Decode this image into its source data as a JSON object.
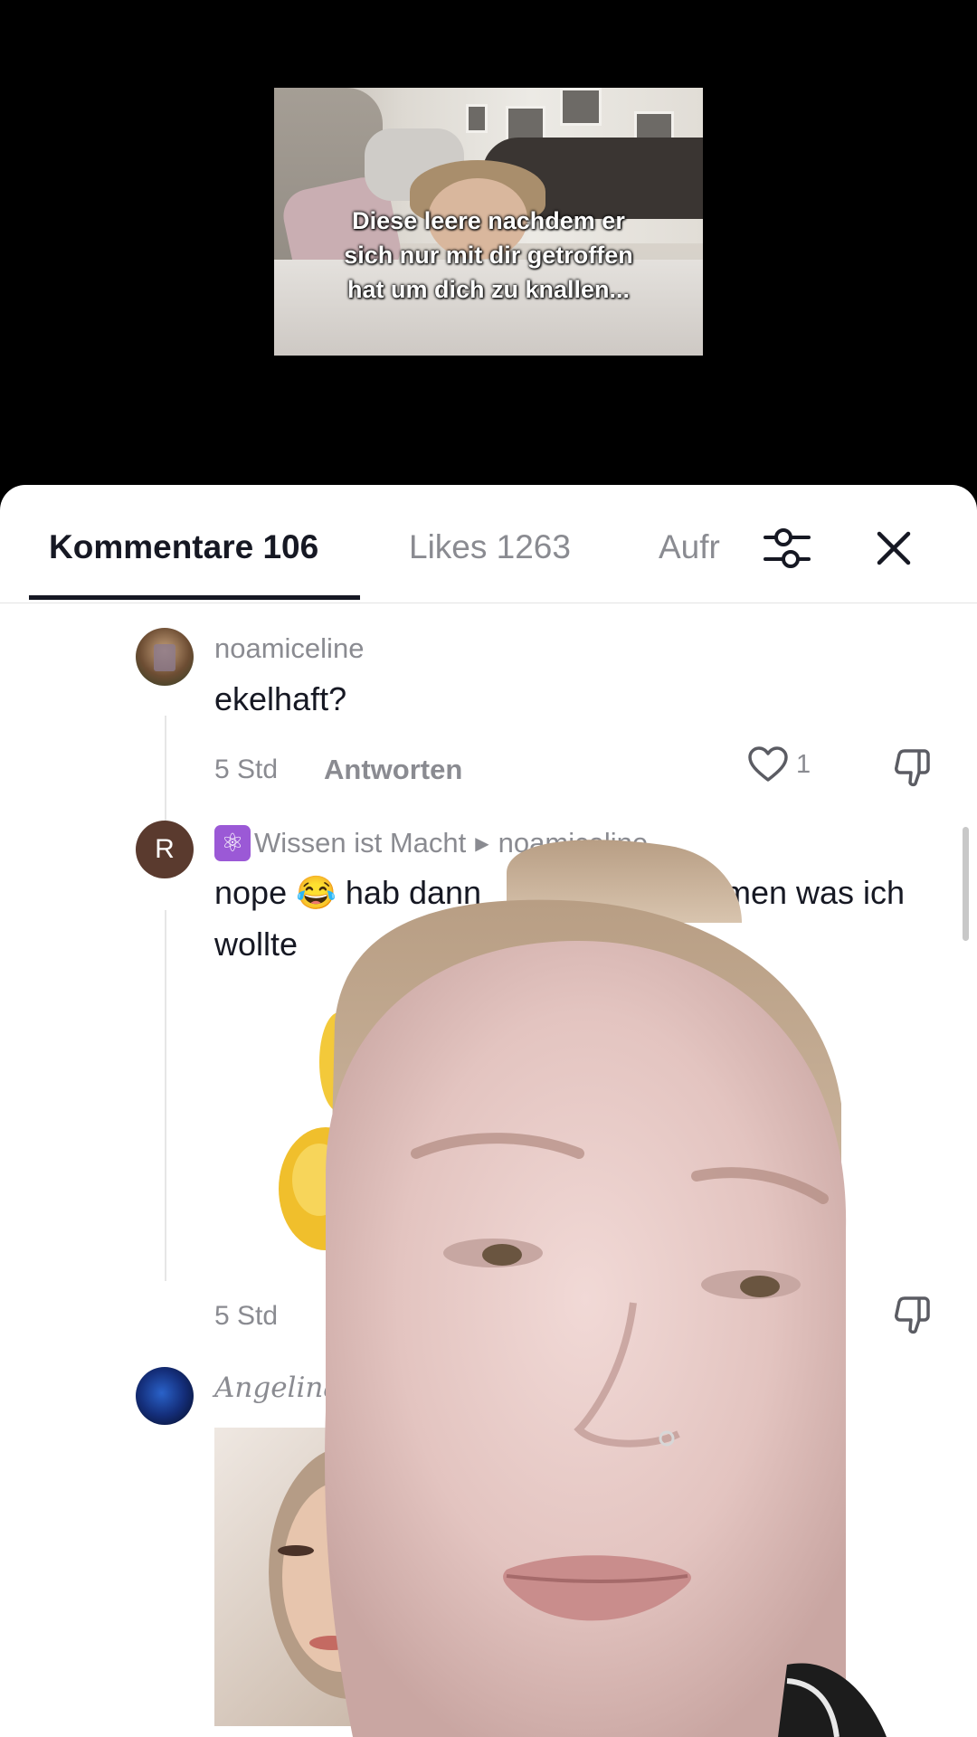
{
  "video": {
    "caption_lines": [
      "Diese leere nachdem er",
      "sich nur mit dir getroffen",
      "hat um dich zu knallen..."
    ]
  },
  "tabs": {
    "comments_label": "Kommentare 106",
    "likes_label": "Likes 1263",
    "views_label_truncated": "Aufr"
  },
  "icons": {
    "filter": "sliders-icon",
    "close": "close-icon",
    "like": "heart-icon",
    "dislike": "thumbs-down-icon",
    "verified_atom": "atom-icon",
    "reply_arrow": "triangle-right-icon"
  },
  "comments": [
    {
      "username": "noamiceline",
      "text": "ekelhaft?",
      "time": "5 Std",
      "reply_label": "Antworten",
      "likes": "1"
    },
    {
      "avatar_letter": "R",
      "username_emoji": "⚛️",
      "username": "Wissen ist Macht",
      "reply_to": "noamiceline",
      "text_line1_left": "nope 😂 hab dann",
      "text_line1_right": "men was ich",
      "text_line2": "wollte",
      "time": "5 Std"
    },
    {
      "username": "Angelina"
    }
  ],
  "colors": {
    "primary_text": "#161823",
    "secondary_text": "#8a8b91",
    "sheet_bg": "#ffffff",
    "video_bg": "#000000",
    "avatar_r_bg": "#5a3a2e"
  }
}
